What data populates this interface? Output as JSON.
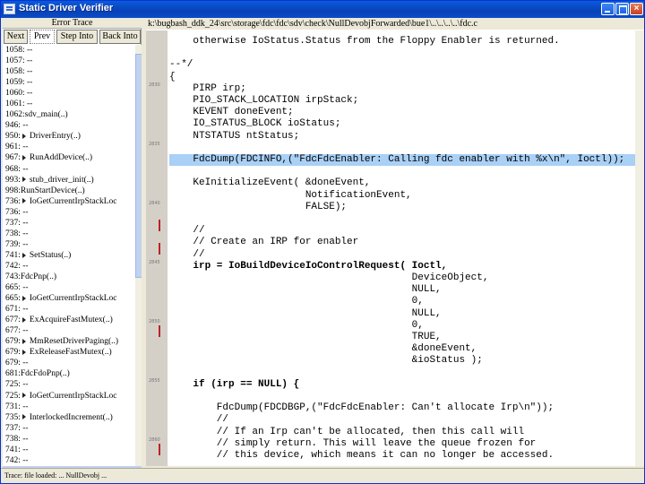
{
  "window": {
    "title": "Static Driver Verifier"
  },
  "left_pane": {
    "header": "Error Trace",
    "tabs": [
      "Next",
      "Prev",
      "Step Into",
      "Back Into"
    ],
    "active_tab": 1,
    "rows": [
      {
        "text": "1058: --",
        "arrow": false
      },
      {
        "text": "1057: --",
        "arrow": false
      },
      {
        "text": "1058: --",
        "arrow": false
      },
      {
        "text": "1059: --",
        "arrow": false
      },
      {
        "text": "1060: --",
        "arrow": false
      },
      {
        "text": "1061: --",
        "arrow": false
      },
      {
        "text": "1062:sdv_main(..)",
        "arrow": false
      },
      {
        "text": "946: --",
        "arrow": false
      },
      {
        "text": "950:",
        "label": "DriverEntry(..)",
        "arrow": true
      },
      {
        "text": "961: --",
        "arrow": false
      },
      {
        "text": "967:",
        "label": "RunAddDevice(..)",
        "arrow": true
      },
      {
        "text": "968: --",
        "arrow": false
      },
      {
        "text": "993:",
        "label": "stub_driver_init(..)",
        "arrow": true
      },
      {
        "text": "998:RunStartDevice(..)",
        "arrow": false
      },
      {
        "text": "736:",
        "label": "IoGetCurrentIrpStackLoc",
        "arrow": true
      },
      {
        "text": "736: --",
        "arrow": false
      },
      {
        "text": "737: --",
        "arrow": false
      },
      {
        "text": "738: --",
        "arrow": false
      },
      {
        "text": "739: --",
        "arrow": false
      },
      {
        "text": "741:",
        "label": "SetStatus(..)",
        "arrow": true
      },
      {
        "text": "742: --",
        "arrow": false
      },
      {
        "text": "743:FdcPnp(..)",
        "arrow": false
      },
      {
        "text": "665: --",
        "arrow": false
      },
      {
        "text": "665:",
        "label": "IoGetCurrentIrpStackLoc",
        "arrow": true
      },
      {
        "text": "671: --",
        "arrow": false
      },
      {
        "text": "677:",
        "label": "ExAcquireFastMutex(..)",
        "arrow": true
      },
      {
        "text": "677: --",
        "arrow": false
      },
      {
        "text": "679:",
        "label": "MmResetDriverPaging(..)",
        "arrow": true
      },
      {
        "text": "679:",
        "label": "ExReleaseFastMutex(..)",
        "arrow": true
      },
      {
        "text": "679: --",
        "arrow": false
      },
      {
        "text": "681:FdcFdoPnp(..)",
        "arrow": false
      },
      {
        "text": "725: --",
        "arrow": false
      },
      {
        "text": "725:",
        "label": "IoGetCurrentIrpStackLoc",
        "arrow": true
      },
      {
        "text": "731: --",
        "arrow": false
      },
      {
        "text": "735:",
        "label": "InterlockedIncrement(..)",
        "arrow": true
      },
      {
        "text": "737: --",
        "arrow": false
      },
      {
        "text": "738: --",
        "arrow": false
      },
      {
        "text": "741: --",
        "arrow": false
      },
      {
        "text": "742: --",
        "arrow": false
      }
    ]
  },
  "path_bar": "k:\\bugbash_ddk_24\\src\\storage\\fdc\\fdc\\sdv\\check\\NullDevobjForwarded\\bue1\\..\\..\\..\\..\\fdc.c",
  "gutter": {
    "nums": [
      "2830",
      "2835",
      "2840",
      "2845",
      "2850",
      "2855",
      "2860"
    ],
    "red_bars": 4
  },
  "code_lines": [
    {
      "text": "    otherwise IoStatus.Status from the Floppy Enabler is returned.",
      "hl": false,
      "b": false
    },
    {
      "text": "",
      "hl": false,
      "b": false
    },
    {
      "text": "--*/",
      "hl": false,
      "b": false
    },
    {
      "text": "{",
      "hl": false,
      "b": false
    },
    {
      "text": "    PIRP irp;",
      "hl": false,
      "b": false
    },
    {
      "text": "    PIO_STACK_LOCATION irpStack;",
      "hl": false,
      "b": false
    },
    {
      "text": "    KEVENT doneEvent;",
      "hl": false,
      "b": false
    },
    {
      "text": "    IO_STATUS_BLOCK ioStatus;",
      "hl": false,
      "b": false
    },
    {
      "text": "    NTSTATUS ntStatus;",
      "hl": false,
      "b": false
    },
    {
      "text": "",
      "hl": false,
      "b": false
    },
    {
      "text": "    FdcDump(FDCINFO,(\"FdcFdcEnabler: Calling fdc enabler with %x\\n\", Ioctl));",
      "hl": true,
      "b": false
    },
    {
      "text": "",
      "hl": false,
      "b": false
    },
    {
      "text": "    KeInitializeEvent( &doneEvent,",
      "hl": false,
      "b": false
    },
    {
      "text": "                       NotificationEvent,",
      "hl": false,
      "b": false
    },
    {
      "text": "                       FALSE);",
      "hl": false,
      "b": false
    },
    {
      "text": "",
      "hl": false,
      "b": false
    },
    {
      "text": "    //",
      "hl": false,
      "b": false
    },
    {
      "text": "    // Create an IRP for enabler",
      "hl": false,
      "b": false
    },
    {
      "text": "    //",
      "hl": false,
      "b": false
    },
    {
      "text": "    irp = IoBuildDeviceIoControlRequest( Ioctl,",
      "hl": false,
      "b": true
    },
    {
      "text": "                                         DeviceObject,",
      "hl": false,
      "b": false
    },
    {
      "text": "                                         NULL,",
      "hl": false,
      "b": false
    },
    {
      "text": "                                         0,",
      "hl": false,
      "b": false
    },
    {
      "text": "                                         NULL,",
      "hl": false,
      "b": false
    },
    {
      "text": "                                         0,",
      "hl": false,
      "b": false
    },
    {
      "text": "                                         TRUE,",
      "hl": false,
      "b": false
    },
    {
      "text": "                                         &doneEvent,",
      "hl": false,
      "b": false
    },
    {
      "text": "                                         &ioStatus );",
      "hl": false,
      "b": false
    },
    {
      "text": "",
      "hl": false,
      "b": false
    },
    {
      "text": "    if (irp == NULL) {",
      "hl": false,
      "b": true
    },
    {
      "text": "",
      "hl": false,
      "b": false
    },
    {
      "text": "        FdcDump(FDCDBGP,(\"FdcFdcEnabler: Can't allocate Irp\\n\"));",
      "hl": false,
      "b": false
    },
    {
      "text": "        //",
      "hl": false,
      "b": false
    },
    {
      "text": "        // If an Irp can't be allocated, then this call will",
      "hl": false,
      "b": false
    },
    {
      "text": "        // simply return. This will leave the queue frozen for",
      "hl": false,
      "b": false
    },
    {
      "text": "        // this device, which means it can no longer be accessed.",
      "hl": false,
      "b": false
    }
  ],
  "status_bar": "Trace: file loaded: ... NullDevobj ..."
}
